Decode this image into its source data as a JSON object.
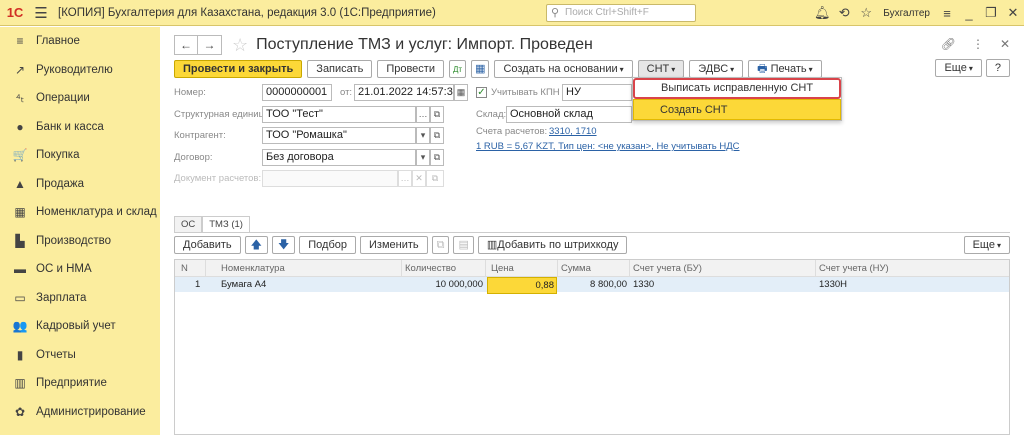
{
  "app": {
    "logo": "1С",
    "title": "[КОПИЯ] Бухгалтерия для Казахстана, редакция 3.0  (1С:Предприятие)",
    "search_placeholder": "Поиск Ctrl+Shift+F",
    "user": "Бухгалтер"
  },
  "sidebar": {
    "items": [
      {
        "label": "Главное",
        "icon": "≡"
      },
      {
        "label": "Руководителю",
        "icon": "↗"
      },
      {
        "label": "Операции",
        "icon": "⁴ₜ"
      },
      {
        "label": "Банк и касса",
        "icon": "●"
      },
      {
        "label": "Покупка",
        "icon": "🛒"
      },
      {
        "label": "Продажа",
        "icon": "▲"
      },
      {
        "label": "Номенклатура и склад",
        "icon": "▦"
      },
      {
        "label": "Производство",
        "icon": "▙"
      },
      {
        "label": "ОС и НМА",
        "icon": "▬"
      },
      {
        "label": "Зарплата",
        "icon": "▭"
      },
      {
        "label": "Кадровый учет",
        "icon": "👥"
      },
      {
        "label": "Отчеты",
        "icon": "▮"
      },
      {
        "label": "Предприятие",
        "icon": "▥"
      },
      {
        "label": "Администрирование",
        "icon": "✿"
      }
    ]
  },
  "document": {
    "title": "Поступление ТМЗ и услуг: Импорт. Проведен",
    "toolbar": {
      "post_close": "Провести и закрыть",
      "save": "Записать",
      "post": "Провести",
      "create_based": "Создать на основании",
      "snt": "СНТ",
      "edvs": "ЭДВС",
      "print": "Печать",
      "more": "Еще",
      "help": "?"
    },
    "fields": {
      "number_label": "Номер:",
      "number": "0000000001",
      "date_label": "от:",
      "date": "21.01.2022 14:57:3",
      "kpn_label": "Учитывать КПН",
      "kpn_value": "НУ",
      "unit_label": "Структурная единица:",
      "unit": "ТОО \"Тест\"",
      "warehouse_label": "Склад:",
      "warehouse": "Основной склад",
      "counterparty_label": "Контрагент:",
      "counterparty": "ТОО \"Ромашка\"",
      "accounts_label": "Счета расчетов:",
      "accounts": "3310, 1710",
      "contract_label": "Договор:",
      "contract": "Без договора",
      "currency_link": "1 RUB = 5,67 KZT, Тип цен: <не указан>, Не учитывать НДС",
      "settlement_doc_label": "Документ расчетов:"
    },
    "dropdown": {
      "items": [
        "Выписать исправленную СНТ",
        "Создать СНТ"
      ]
    },
    "tabs": [
      "ОС",
      "ТМЗ (1)"
    ],
    "table_toolbar": {
      "add": "Добавить",
      "select": "Подбор",
      "change": "Изменить",
      "barcode": "Добавить по штрихкоду",
      "more": "Еще"
    },
    "table": {
      "columns": [
        "N",
        "Номенклатура",
        "Количество",
        "Цена",
        "Сумма",
        "Счет учета (БУ)",
        "Счет учета (НУ)"
      ],
      "rows": [
        {
          "n": "1",
          "item": "Бумага А4",
          "qty": "10 000,000",
          "price": "0,88",
          "sum": "8 800,00",
          "acc_bu": "1330",
          "acc_nu": "1330Н"
        }
      ]
    }
  }
}
